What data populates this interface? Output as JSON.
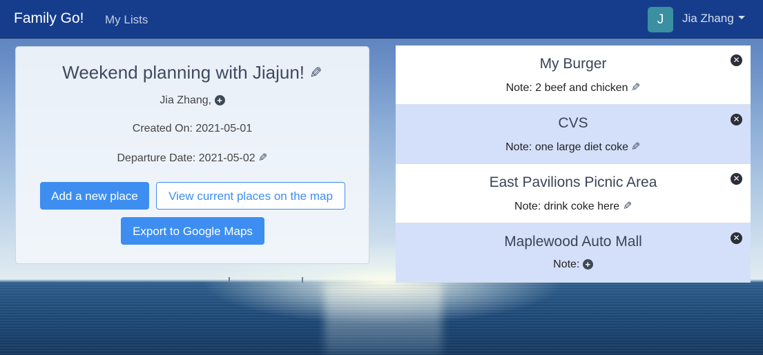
{
  "navbar": {
    "brand": "Family Go!",
    "nav_link": "My Lists",
    "avatar_initial": "J",
    "user_name": "Jia Zhang"
  },
  "info_card": {
    "title": "Weekend planning with Jiajun!",
    "owner": "Jia Zhang,",
    "created": "Created On: 2021-05-01",
    "departure": "Departure Date: 2021-05-02",
    "buttons": {
      "add_place": "Add a new place",
      "view_map": "View current places on the map",
      "export": "Export to Google Maps"
    }
  },
  "places": [
    {
      "name": "My Burger",
      "note": "Note: 2 beef and chicken",
      "has_note": true
    },
    {
      "name": "CVS",
      "note": "Note: one large diet coke",
      "has_note": true
    },
    {
      "name": "East Pavilions Picnic Area",
      "note": "Note: drink coke here",
      "has_note": true
    },
    {
      "name": "Maplewood Auto Mall",
      "note": "Note:",
      "has_note": false
    }
  ],
  "icons": {
    "edit": "pencil-icon",
    "add": "plus-circle-icon",
    "remove": "close-circle-icon",
    "dropdown": "caret-down-icon"
  },
  "colors": {
    "navbar": "#163d8c",
    "primary": "#3d8ef0",
    "row_alt": "#d4e0fa",
    "avatar": "#3a8fa0"
  }
}
